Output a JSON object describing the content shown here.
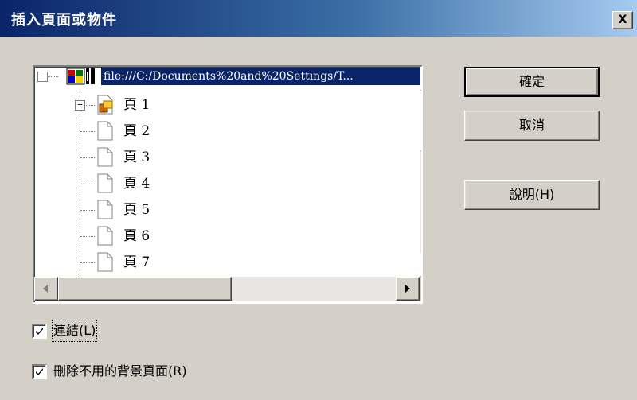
{
  "dialog": {
    "title": "插入頁面或物件",
    "close_label": "X"
  },
  "tree": {
    "root_label": "file:///C:/Documents%20and%20Settings/T...",
    "pages": [
      {
        "label": "頁 1",
        "icon": "object-page-icon",
        "expandable": true
      },
      {
        "label": "頁 2",
        "icon": "page-icon",
        "expandable": false
      },
      {
        "label": "頁 3",
        "icon": "page-icon",
        "expandable": false
      },
      {
        "label": "頁 4",
        "icon": "page-icon",
        "expandable": false
      },
      {
        "label": "頁 5",
        "icon": "page-icon",
        "expandable": false
      },
      {
        "label": "頁 6",
        "icon": "page-icon",
        "expandable": false
      },
      {
        "label": "頁 7",
        "icon": "page-icon",
        "expandable": false
      }
    ]
  },
  "buttons": {
    "ok": "確定",
    "cancel": "取消",
    "help": "說明(H)"
  },
  "options": {
    "link": {
      "label": "連結(L)",
      "checked": true
    },
    "delete_unused_backgrounds": {
      "label": "刪除不用的背景頁面(R)",
      "checked": true
    }
  }
}
